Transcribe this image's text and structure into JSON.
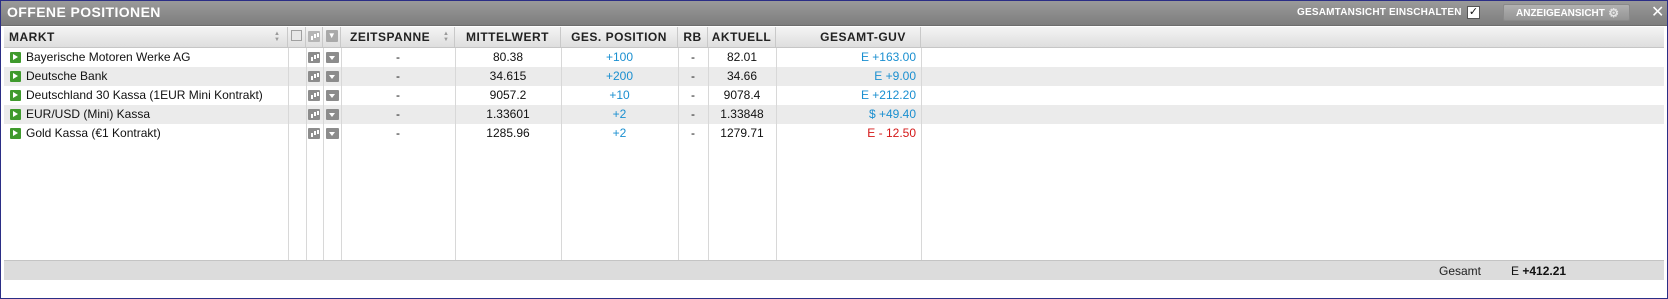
{
  "window": {
    "title": "OFFENE POSITIONEN",
    "overview_label": "GESAMTANSICHT EINSCHALTEN",
    "overview_checked": "✓",
    "view_button_label": "ANZEIGEANSICHT",
    "close_symbol": "✕"
  },
  "columns": {
    "market": "MARKT",
    "timespan": "ZEITSPANNE",
    "average": "MITTELWERT",
    "total_position": "GES. POSITION",
    "rb": "RB",
    "current": "AKTUELL",
    "total_pl": "GESAMT-GUV"
  },
  "rows": [
    {
      "market": "Bayerische Motoren Werke AG",
      "timespan": "-",
      "average": "80.38",
      "position": "+100",
      "rb": "-",
      "current": "82.01",
      "pl": "E +163.00",
      "pl_sign": "pos"
    },
    {
      "market": "Deutsche Bank",
      "timespan": "-",
      "average": "34.615",
      "position": "+200",
      "rb": "-",
      "current": "34.66",
      "pl": "E +9.00",
      "pl_sign": "pos"
    },
    {
      "market": "Deutschland 30 Kassa (1EUR Mini Kontrakt)",
      "timespan": "-",
      "average": "9057.2",
      "position": "+10",
      "rb": "-",
      "current": "9078.4",
      "pl": "E +212.20",
      "pl_sign": "pos"
    },
    {
      "market": "EUR/USD (Mini) Kassa",
      "timespan": "-",
      "average": "1.33601",
      "position": "+2",
      "rb": "-",
      "current": "1.33848",
      "pl": "$ +49.40",
      "pl_sign": "pos"
    },
    {
      "market": "Gold Kassa (€1 Kontrakt)",
      "timespan": "-",
      "average": "1285.96",
      "position": "+2",
      "rb": "-",
      "current": "1279.71",
      "pl": "E - 12.50",
      "pl_sign": "neg"
    }
  ],
  "footer": {
    "total_label": "Gesamt",
    "total_currency": "E",
    "total_value": "+412.21"
  },
  "colors": {
    "positive": "#1a8fd0",
    "negative": "#d41818",
    "play_icon": "#3f9a2d",
    "title_bar": "#8a8a8a",
    "border": "#2c2f8c"
  },
  "icons": {
    "row_action": "play-icon",
    "row_chart": "chart-icon",
    "row_menu": "dropdown-icon",
    "settings": "gear-icon",
    "close": "close-icon"
  }
}
